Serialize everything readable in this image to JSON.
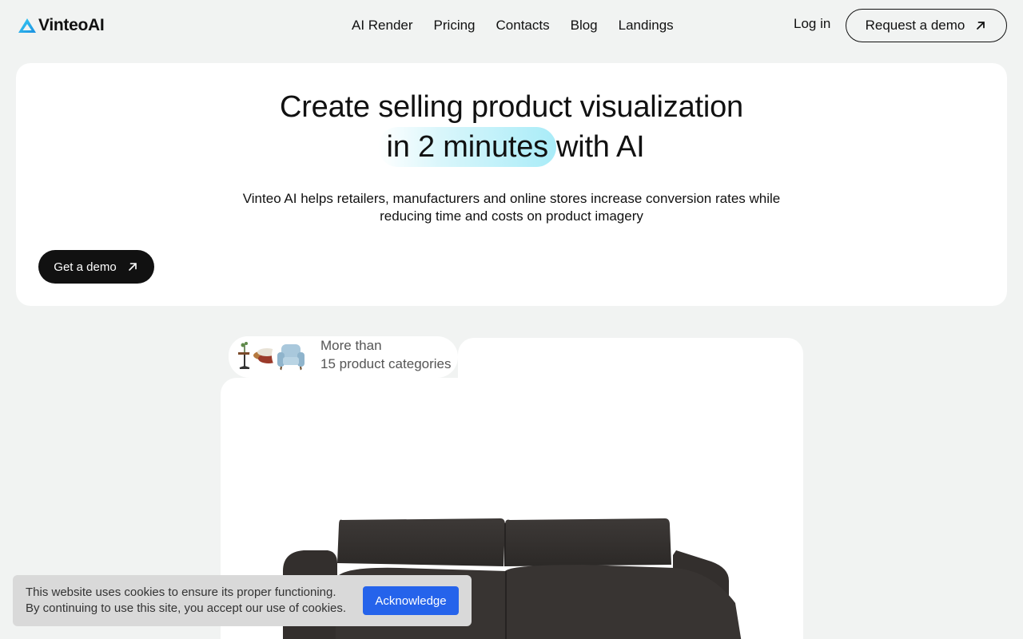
{
  "header": {
    "logo_text": "VinteoAI",
    "nav": [
      "AI Render",
      "Pricing",
      "Contacts",
      "Blog",
      "Landings"
    ],
    "login": "Log in",
    "request_demo": "Request a demo"
  },
  "hero": {
    "title_line1": "Create selling product visualization",
    "title_highlight": "in 2 minutes",
    "title_rest": "with AI",
    "subtitle": "Vinteo AI helps retailers, manufacturers and online stores increase conversion rates while reducing time and costs on product imagery",
    "cta": "Get a demo"
  },
  "showcase": {
    "categories_line1": "More than",
    "categories_line2": "15 product categories"
  },
  "cookie": {
    "line1": "This website uses cookies to ensure its proper functioning.",
    "line2": "By continuing to use this site, you accept our use of cookies.",
    "button": "Acknowledge"
  },
  "colors": {
    "accent_blue": "#2563eb",
    "logo_cyan": "#1fb8e8",
    "highlight": "#a9ecf8",
    "dark": "#111111"
  }
}
